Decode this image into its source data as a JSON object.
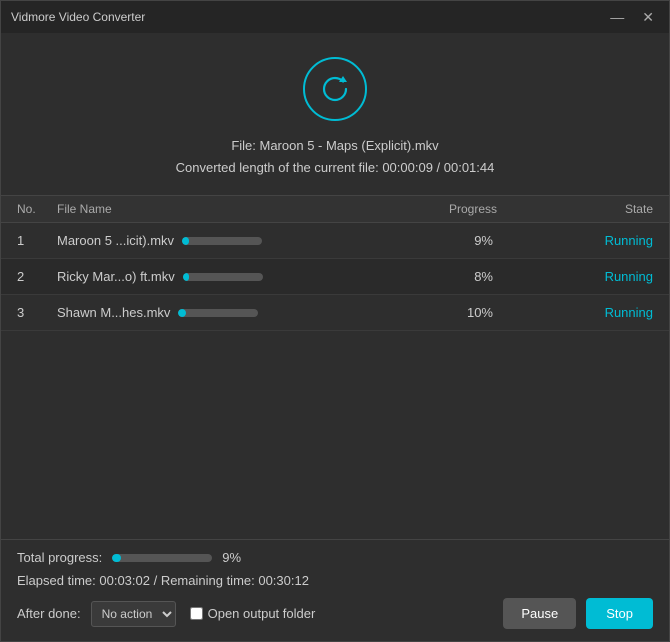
{
  "window": {
    "title": "Vidmore Video Converter",
    "minimize_label": "—",
    "close_label": "✕"
  },
  "top": {
    "refresh_icon": "refresh-icon",
    "file_line1": "File: Maroon 5 - Maps (Explicit).mkv",
    "file_line2": "Converted length of the current file: 00:00:09 / 00:01:44"
  },
  "table": {
    "headers": {
      "no": "No.",
      "filename": "File Name",
      "progress": "Progress",
      "state": "State"
    },
    "rows": [
      {
        "no": "1",
        "filename": "Maroon 5 ...icit).mkv",
        "progress_pct": "9%",
        "progress_val": 9,
        "state": "Running"
      },
      {
        "no": "2",
        "filename": "Ricky Mar...o) ft.mkv",
        "progress_pct": "8%",
        "progress_val": 8,
        "state": "Running"
      },
      {
        "no": "3",
        "filename": "Shawn M...hes.mkv",
        "progress_pct": "10%",
        "progress_val": 10,
        "state": "Running"
      }
    ]
  },
  "footer": {
    "total_progress_label": "Total progress:",
    "total_pct": "9%",
    "total_val": 9,
    "time_info": "Elapsed time: 00:03:02 / Remaining time: 00:30:12",
    "after_done_label": "After done:",
    "no_action_option": "No action",
    "open_folder_label": "Open output folder",
    "pause_label": "Pause",
    "stop_label": "Stop"
  }
}
